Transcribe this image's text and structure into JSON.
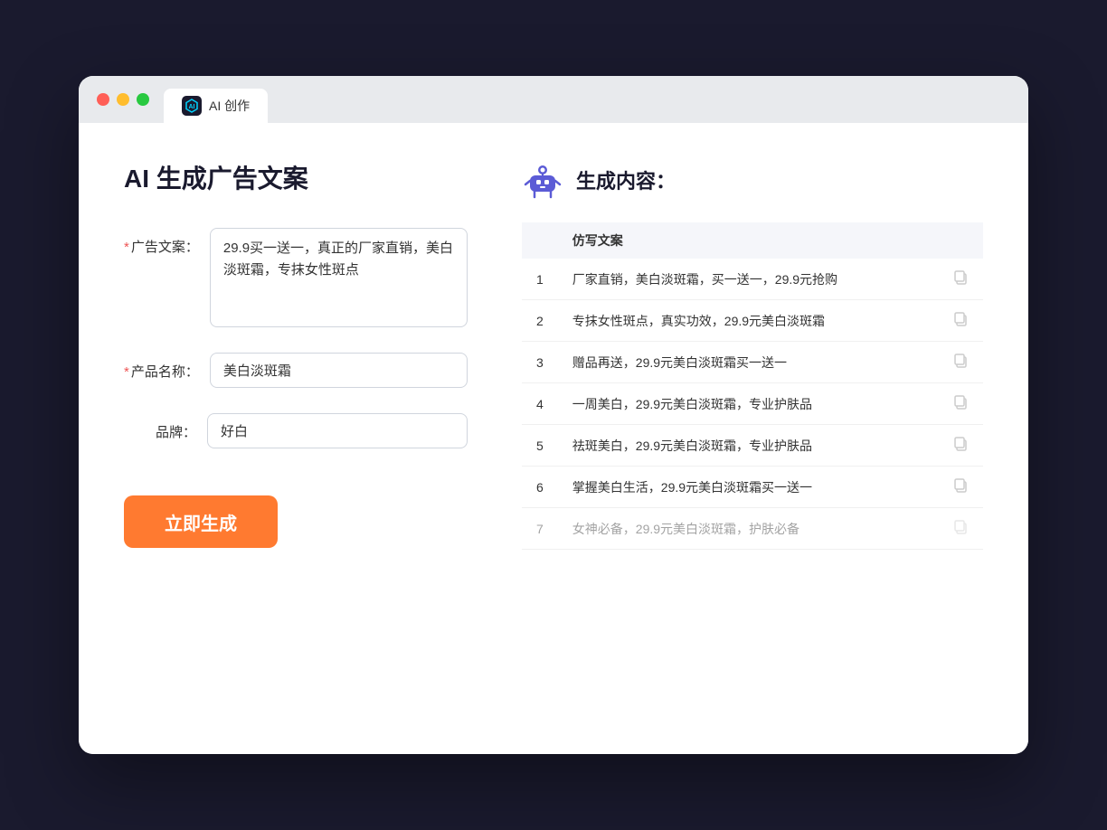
{
  "window": {
    "tab_label": "AI 创作"
  },
  "left": {
    "title": "AI 生成广告文案",
    "fields": [
      {
        "id": "ad_copy",
        "label": "广告文案：",
        "required": true,
        "type": "textarea",
        "value": "29.9买一送一，真正的厂家直销，美白淡斑霜，专抹女性斑点"
      },
      {
        "id": "product_name",
        "label": "产品名称：",
        "required": true,
        "type": "input",
        "value": "美白淡斑霜"
      },
      {
        "id": "brand",
        "label": "品牌：",
        "required": false,
        "type": "input",
        "value": "好白"
      }
    ],
    "generate_btn": "立即生成"
  },
  "right": {
    "title": "生成内容：",
    "table_header": "仿写文案",
    "results": [
      {
        "num": "1",
        "text": "厂家直销，美白淡斑霜，买一送一，29.9元抢购"
      },
      {
        "num": "2",
        "text": "专抹女性斑点，真实功效，29.9元美白淡斑霜"
      },
      {
        "num": "3",
        "text": "赠品再送，29.9元美白淡斑霜买一送一"
      },
      {
        "num": "4",
        "text": "一周美白，29.9元美白淡斑霜，专业护肤品"
      },
      {
        "num": "5",
        "text": "祛斑美白，29.9元美白淡斑霜，专业护肤品"
      },
      {
        "num": "6",
        "text": "掌握美白生活，29.9元美白淡斑霜买一送一"
      },
      {
        "num": "7",
        "text": "女神必备，29.9元美白淡斑霜，护肤必备"
      }
    ]
  },
  "icons": {
    "copy": "⊡",
    "robot_color": "#5b5bd6"
  }
}
